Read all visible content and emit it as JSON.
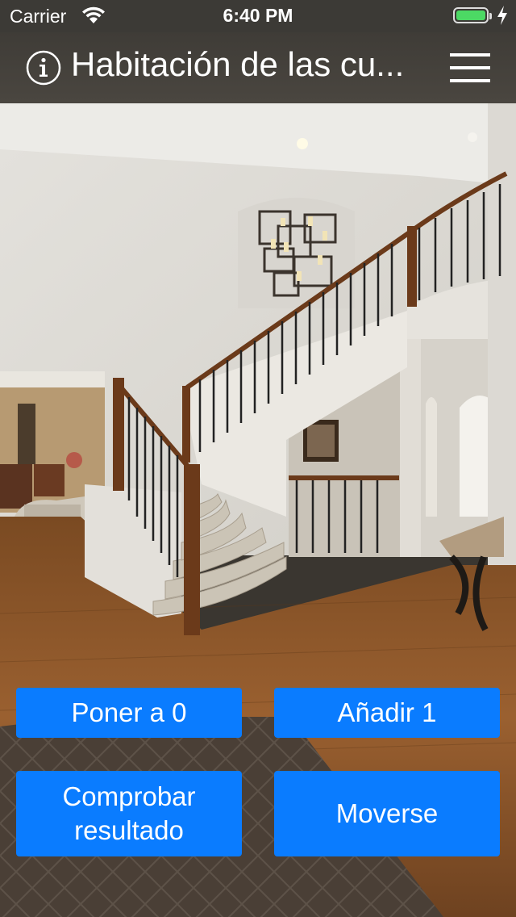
{
  "status_bar": {
    "carrier": "Carrier",
    "time": "6:40 PM",
    "battery_level": 1.0,
    "battery_color": "#4cd964"
  },
  "nav": {
    "title": "Habitación de las cu...",
    "left_icon": "info-icon",
    "right_icon": "hamburger-menu-icon"
  },
  "background": {
    "description_icon": "staircase-room-photo"
  },
  "buttons": {
    "reset_label": "Poner a 0",
    "add_label": "Añadir 1",
    "check_label": "Comprobar resultado",
    "move_label": "Moverse",
    "color": "#0a7cff"
  }
}
